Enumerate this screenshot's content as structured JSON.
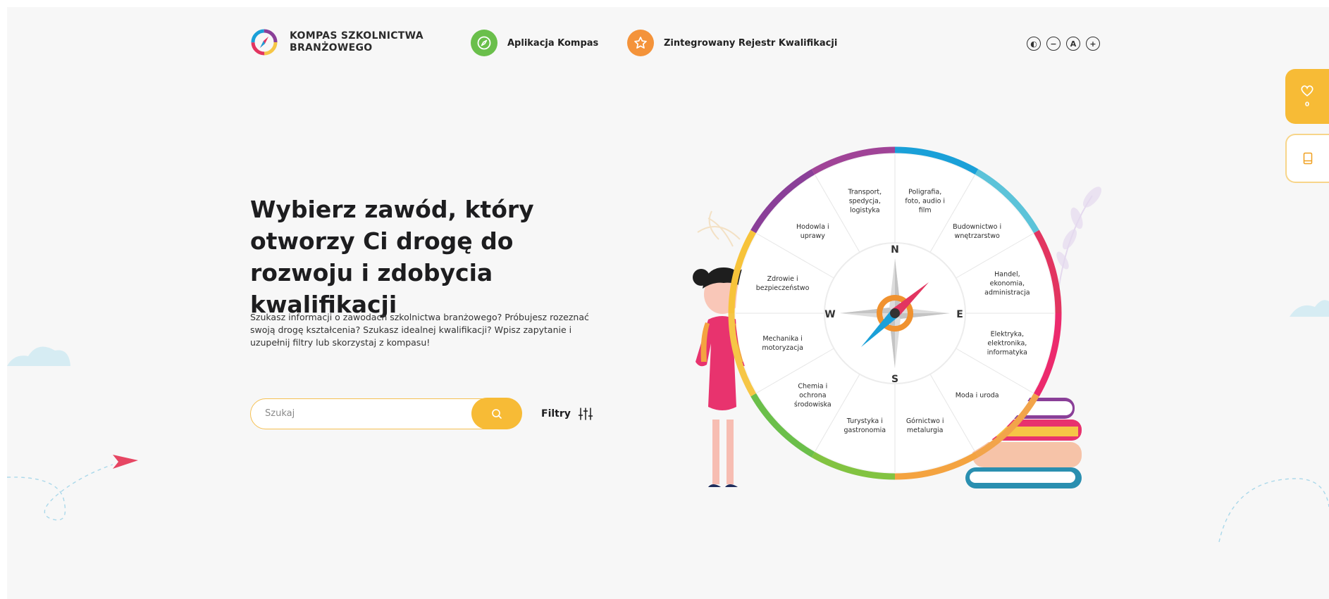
{
  "header": {
    "logo_line1": "KOMPAS SZKOLNICTWA",
    "logo_line2": "BRANŻOWEGO",
    "nav_compass": "Aplikacja Kompas",
    "nav_registry": "Zintegrowany Rejestr Kwalifikacji",
    "a11y_contrast": "◐",
    "a11y_minus": "−",
    "a11y_reset": "A",
    "a11y_plus": "+"
  },
  "side": {
    "favorites_count": "0"
  },
  "hero": {
    "headline": "Wybierz zawód, który otworzy Ci drogę do rozwoju i zdobycia kwalifikacji",
    "lead": "Szukasz informacji o zawodach szkolnictwa branżowego? Próbujesz rozeznać swoją drogę kształcenia? Szukasz idealnej kwalifikacji? Wpisz zapytanie i uzupełnij filtry lub skorzystaj z kompasu!"
  },
  "search": {
    "placeholder": "Szukaj",
    "value": ""
  },
  "filters": {
    "label": "Filtry"
  },
  "compass": {
    "directions": {
      "n": "N",
      "s": "S",
      "e": "E",
      "w": "W"
    },
    "sectors": [
      [
        "Poligrafia,",
        "foto, audio i",
        "film"
      ],
      [
        "Budownictwo i",
        "wnętrzarstwo"
      ],
      [
        "Handel,",
        "ekonomia,",
        "administracja"
      ],
      [
        "Elektryka,",
        "elektronika,",
        "informatyka"
      ],
      [
        "Moda i uroda"
      ],
      [
        "Górnictwo i",
        "metalurgia"
      ],
      [
        "Turystyka i",
        "gastronomia"
      ],
      [
        "Chemia i",
        "ochrona",
        "środowiska"
      ],
      [
        "Mechanika i",
        "motoryzacja"
      ],
      [
        "Zdrowie i",
        "bezpieczeństwo"
      ],
      [
        "Hodowla i",
        "uprawy"
      ],
      [
        "Transport,",
        "spedycja,",
        "logistyka"
      ]
    ],
    "ring_colors": [
      "#1aa0d8",
      "#5cc3d9",
      "#e23560",
      "#ec2a6d",
      "#f2a44a",
      "#f4a340",
      "#82c341",
      "#6bbf4a",
      "#f6c646",
      "#f7c33a",
      "#8a3f98",
      "#a04497"
    ],
    "accent_orange": "#f0922f"
  },
  "colors": {
    "accent": "#f7bb36",
    "compass_green": "#6abf4b",
    "registry_orange": "#f4933a"
  }
}
